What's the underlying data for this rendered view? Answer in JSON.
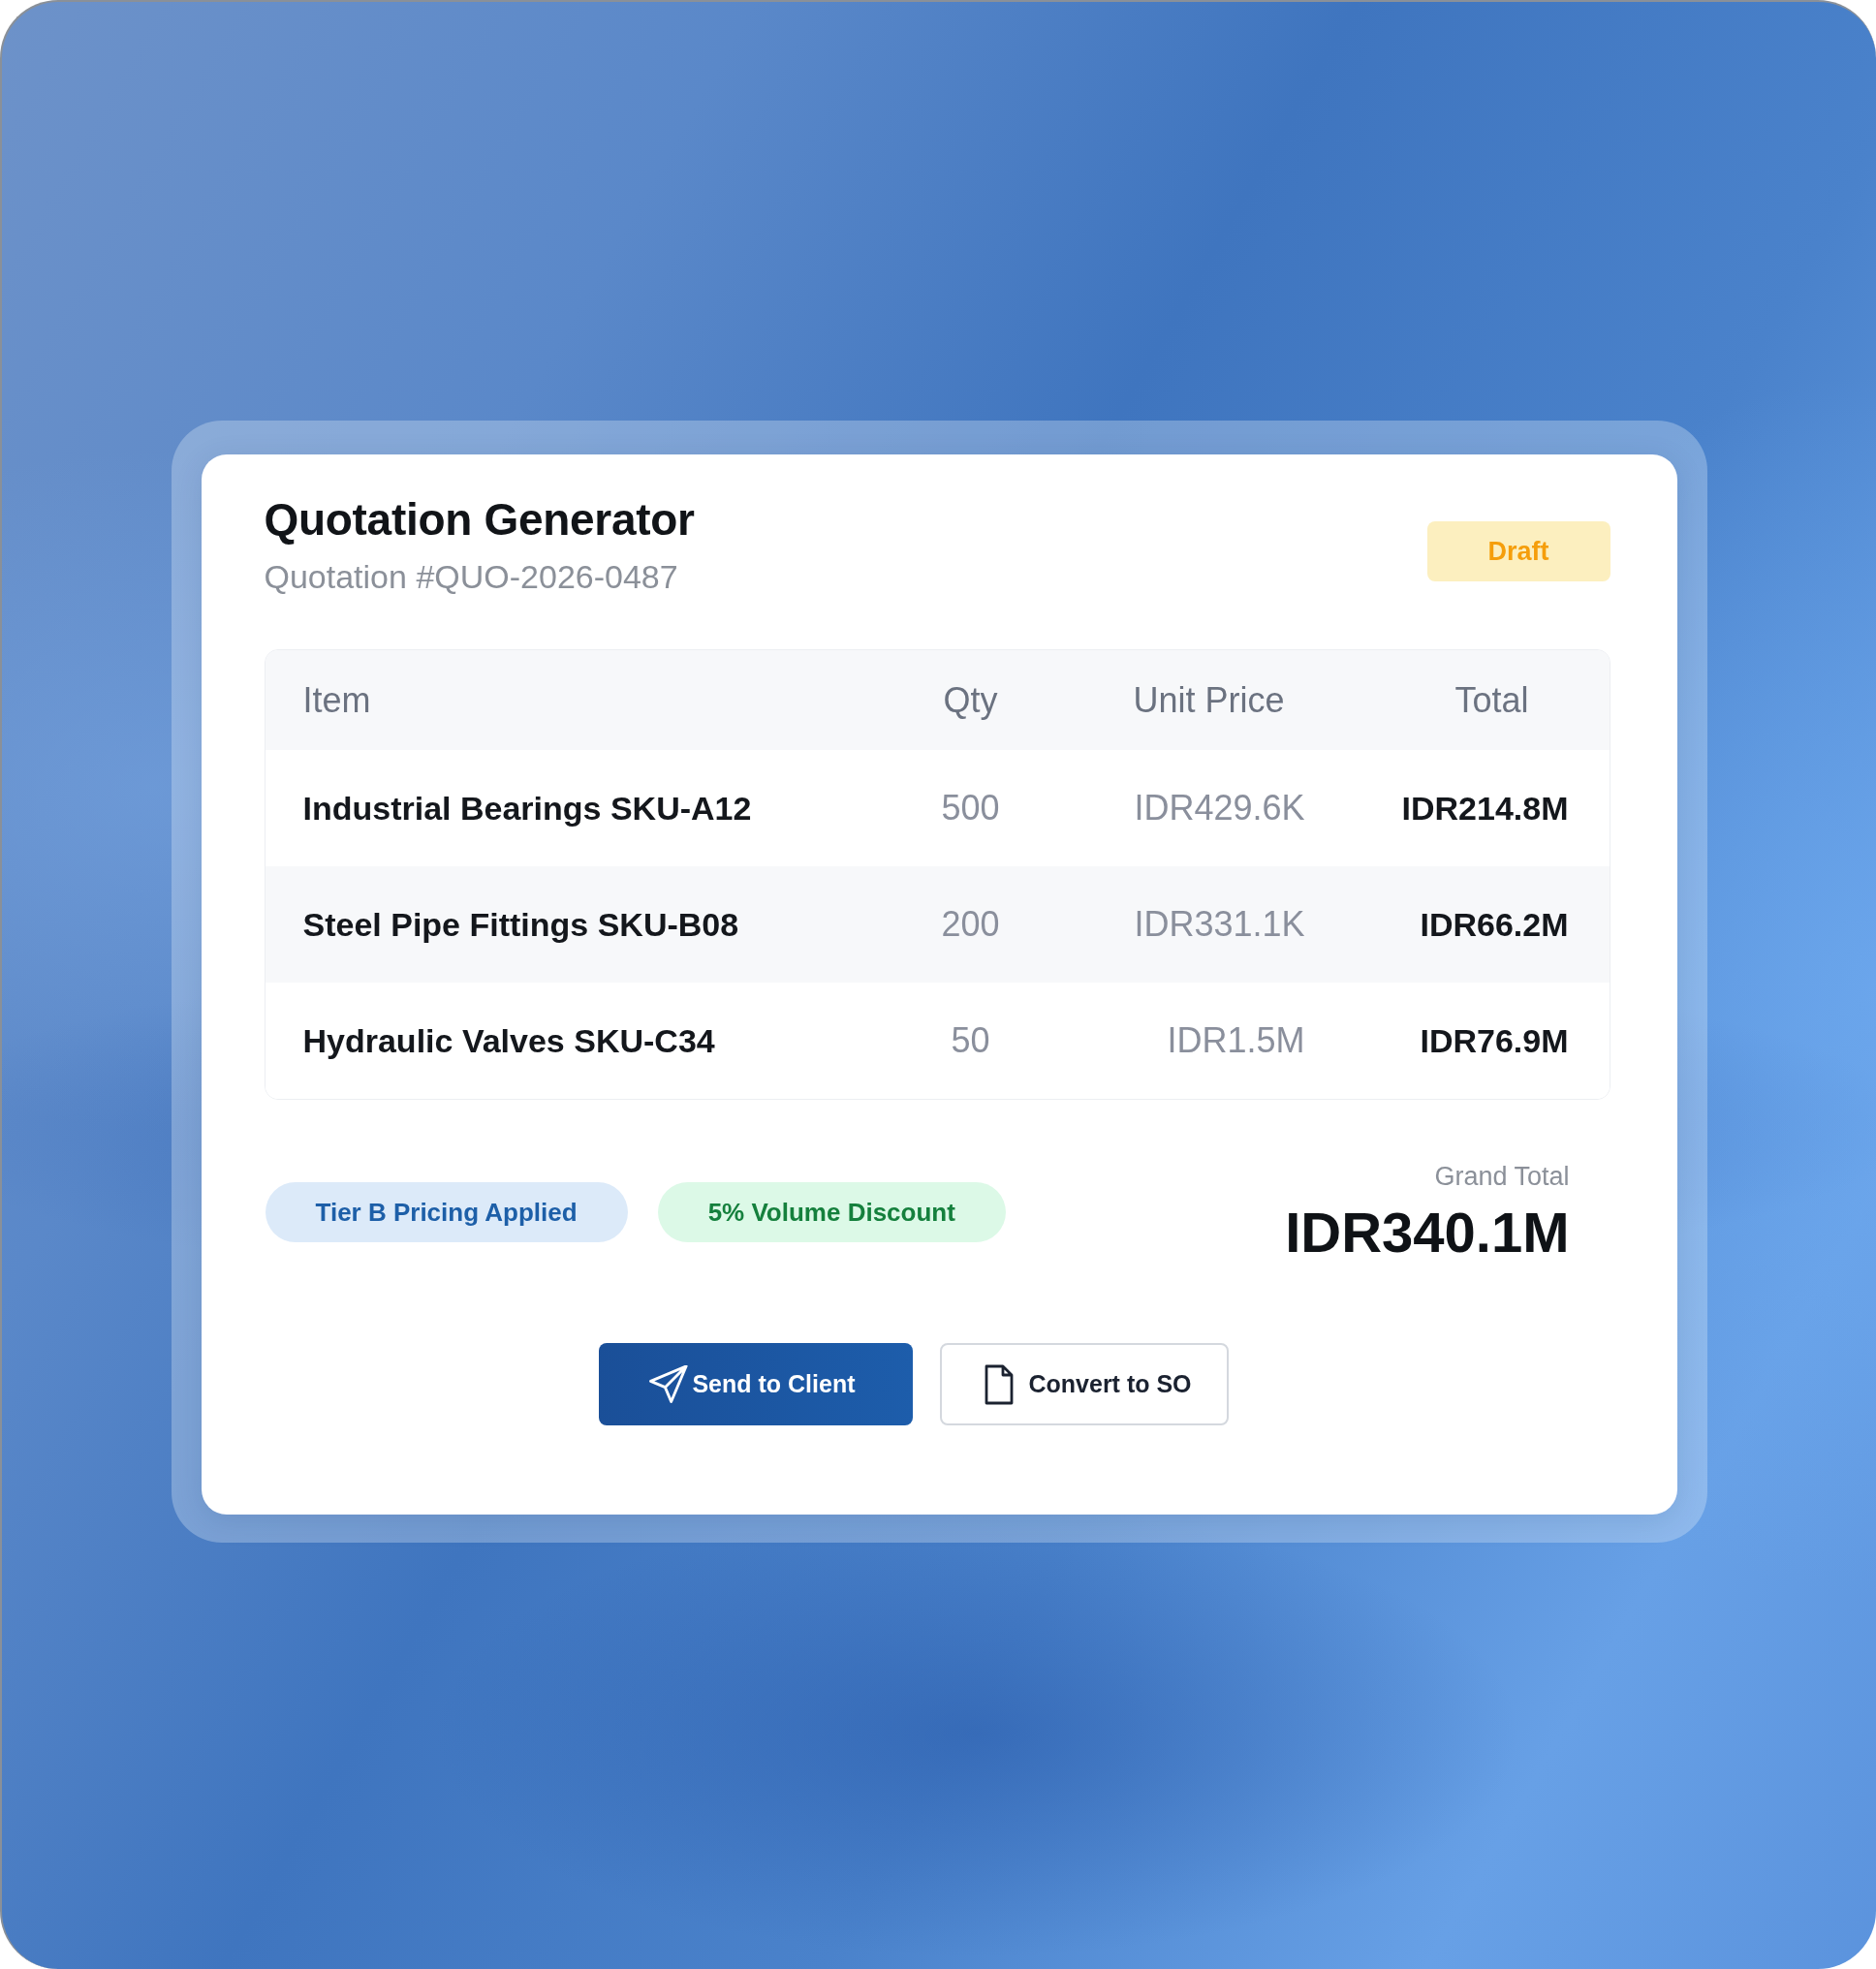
{
  "header": {
    "title": "Quotation Generator",
    "subtitle": "Quotation #QUO-2026-0487",
    "status": {
      "label": "Draft",
      "kind": "draft"
    }
  },
  "table": {
    "columns": [
      "Item",
      "Qty",
      "Unit Price",
      "Total"
    ],
    "rows": [
      [
        "Industrial Bearings SKU-A12",
        "500",
        "IDR429.6K",
        "IDR214.8M"
      ],
      [
        "Steel Pipe Fittings SKU-B08",
        "200",
        "IDR331.1K",
        "IDR66.2M"
      ],
      [
        "Hydraulic Valves SKU-C34",
        "50",
        "IDR1.5M",
        "IDR76.9M"
      ]
    ]
  },
  "tags": [
    {
      "label": "Tier B Pricing Applied",
      "color": "#1d5fa8"
    },
    {
      "label": "5% Volume Discount",
      "color": "#15803d"
    }
  ],
  "grand_total": {
    "label": "Grand Total",
    "value": "IDR340.1M"
  },
  "actions": [
    {
      "label": "Send to Client",
      "kind": "primary"
    },
    {
      "label": "Convert to SO",
      "kind": "secondary"
    }
  ]
}
